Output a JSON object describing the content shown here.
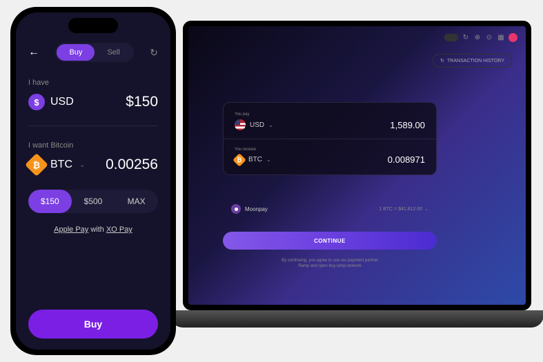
{
  "laptop": {
    "transaction_history": "TRANSACTION HISTORY",
    "pay_label": "You pay",
    "pay_currency": "USD",
    "pay_amount": "1,589.00",
    "receive_label": "You receive",
    "receive_currency": "BTC",
    "receive_amount": "0.008971",
    "provider": "Moonpay",
    "rate": "1 BTC = $41,812.00",
    "continue": "CONTINUE",
    "disclaimer_line1": "By continuing, you agree to use our payment partner",
    "disclaimer_line2": "Ramp and open buy.ramp.network"
  },
  "phone": {
    "tabs": {
      "buy": "Buy",
      "sell": "Sell"
    },
    "have_label": "I have",
    "have_currency": "USD",
    "have_amount": "$150",
    "want_label": "I want Bitcoin",
    "want_currency": "BTC",
    "want_amount": "0.00256",
    "presets": [
      "$150",
      "$500",
      "MAX"
    ],
    "pay_method_1": "Apple Pay",
    "pay_method_mid": " with ",
    "pay_method_2": "XO Pay",
    "buy_button": "Buy"
  }
}
